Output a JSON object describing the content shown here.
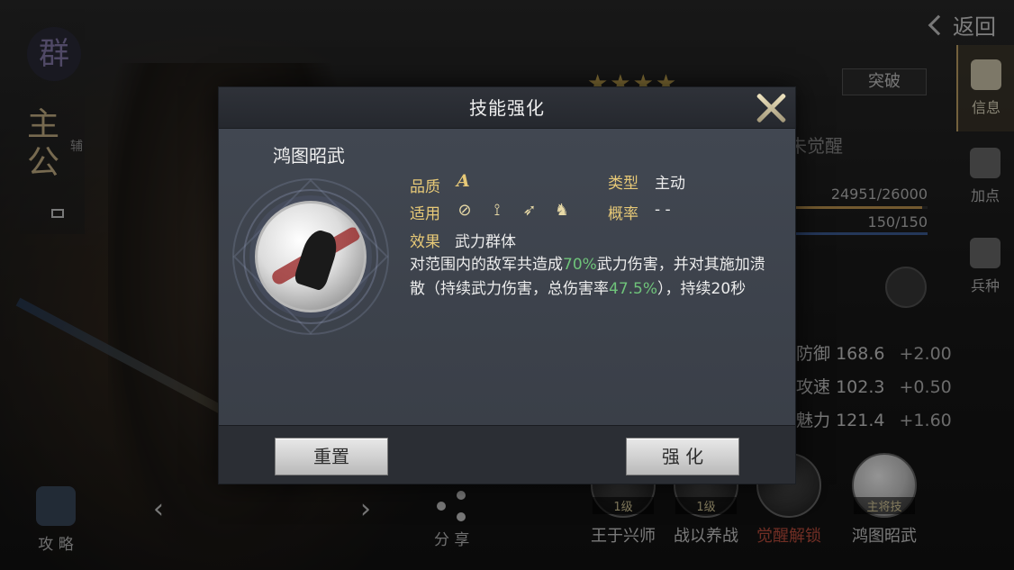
{
  "topbar": {
    "back_label": "返回"
  },
  "banner": {
    "seal_char": "群",
    "main_text": "主公",
    "sub_text": "辅"
  },
  "side_nav": [
    {
      "label": "信息",
      "icon": "scroll-icon",
      "active": true
    },
    {
      "label": "加点",
      "icon": "attributes-icon",
      "active": false
    },
    {
      "label": "兵种",
      "icon": "soldier-icon",
      "active": false
    }
  ],
  "hero_panel": {
    "stars": "★★★★",
    "breakthrough_label": "突破",
    "awaken_status": "未觉醒",
    "exp_text": "24951/26000",
    "exp_fraction": 0.96,
    "troops_text": "150/150",
    "troops_fraction": 1.0,
    "stats": [
      {
        "name": "防御",
        "value": "168.6",
        "inc": "+2.00"
      },
      {
        "name": "攻速",
        "value": "102.3",
        "inc": "+0.50"
      },
      {
        "name": "魅力",
        "value": "121.4",
        "inc": "+1.60"
      }
    ]
  },
  "bottom": {
    "strategy_label": "攻 略",
    "share_label": "分 享",
    "prev_arrow": "‹",
    "next_arrow": "›",
    "skills": [
      {
        "level": "1级",
        "name": "王于兴师",
        "locked": false
      },
      {
        "level": "1级",
        "name": "战以养战",
        "locked": false
      },
      {
        "level": "",
        "name": "觉醒解锁",
        "locked": true
      },
      {
        "level": "主将技",
        "name": "鸿图昭武",
        "locked": false
      }
    ]
  },
  "modal": {
    "title": "技能强化",
    "skill_name": "鸿图昭武",
    "quality_label": "品质",
    "quality_value": "A",
    "type_label": "类型",
    "type_value": "主动",
    "applicable_label": "适用",
    "applicable_icons": [
      "shield-icon",
      "bow-icon",
      "spear-icon",
      "horse-icon"
    ],
    "rate_label": "概率",
    "rate_value": "- -",
    "effect_label": "效果",
    "effect_value": "武力群体",
    "desc_part1": "对范围内的敌军共造成",
    "desc_hl1": "70%",
    "desc_part2": "武力伤害，并对其施加溃散（持续武力伤害，总伤害率",
    "desc_hl2": "47.5%",
    "desc_part3": "），持续20秒",
    "reset_label": "重置",
    "enhance_label": "强 化"
  },
  "colors": {
    "accent_gold": "#e7c977",
    "highlight_green": "#6fc37a",
    "locked_red": "#c2503f"
  }
}
